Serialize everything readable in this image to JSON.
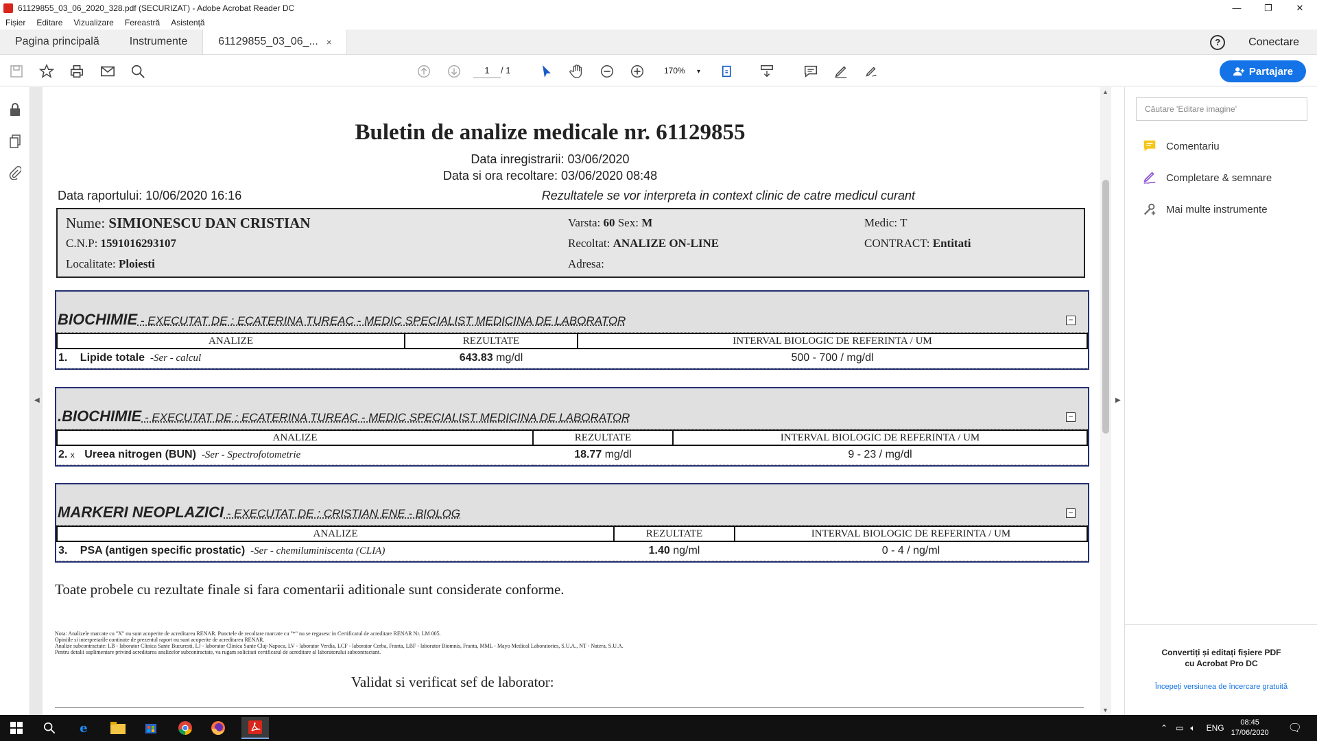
{
  "window": {
    "title": "61129855_03_06_2020_328.pdf (SECURIZAT) - Adobe Acrobat Reader DC",
    "minimize": "—",
    "restore": "❐",
    "close": "✕"
  },
  "menu": [
    "Fișier",
    "Editare",
    "Vizualizare",
    "Fereastră",
    "Asistență"
  ],
  "tabs": {
    "home": "Pagina principală",
    "tools": "Instrumente",
    "document": "61129855_03_06_...",
    "close": "×"
  },
  "header": {
    "help": "?",
    "signin": "Conectare"
  },
  "toolbar": {
    "page_current": "1",
    "page_total": "/ 1",
    "zoom": "170%",
    "zoom_caret": "▾",
    "share": "Partajare"
  },
  "icons": {
    "save": "save-icon",
    "star": "star-icon",
    "print": "print-icon",
    "mail": "mail-icon",
    "search": "search-icon"
  },
  "right_panel": {
    "search_placeholder": "Căutare 'Editare imagine'",
    "items": [
      "Comentariu",
      "Completare & semnare",
      "Mai multe instrumente"
    ],
    "promo_line1": "Convertiți și editați fișiere PDF",
    "promo_line2": "cu Acrobat Pro DC",
    "promo_link": "Începeți versiunea de încercare gratuită"
  },
  "document": {
    "title": "Buletin de analize medicale nr. 61129855",
    "date_reg": "Data inregistrarii: 03/06/2020",
    "date_collect": "Data si ora recoltare: 03/06/2020 08:48",
    "report_date": "Data raportului: 10/06/2020 16:16",
    "report_note": "Rezultatele se vor interpreta in context clinic de catre medicul curant",
    "patient": {
      "name_label": "Nume:",
      "name": "SIMIONESCU DAN CRISTIAN",
      "cnp_label": "C.N.P:",
      "cnp": "1591016293107",
      "loc_label": "Localitate:",
      "loc": "Ploiesti",
      "age_label": "Varsta:",
      "age": "60",
      "sex_label": "Sex:",
      "sex": "M",
      "collected_label": "Recoltat:",
      "collected": "ANALIZE ON-LINE",
      "address_label": "Adresa:",
      "medic_label": "Medic:",
      "medic": "T",
      "contract_label": "CONTRACT:",
      "contract": "Entitati"
    },
    "columns": {
      "analysis": "ANALIZE",
      "result": "REZULTATE",
      "interval": "INTERVAL BIOLOGIC DE REFERINTA / UM"
    },
    "sections": [
      {
        "name": "BIOCHIMIE",
        "executed": " - EXECUTAT DE : ECATERINA TUREAC - MEDIC SPECIALIST MEDICINA DE LABORATOR",
        "minus": "−",
        "row": {
          "num": "1.",
          "flag": "",
          "test": "Lipide totale",
          "method": "-Ser - calcul",
          "value": "643.83",
          "unit": "mg/dl",
          "ref": "500 - 700 / mg/dl"
        }
      },
      {
        "name": ".BIOCHIMIE",
        "executed": " - EXECUTAT DE : ECATERINA TUREAC - MEDIC SPECIALIST MEDICINA DE LABORATOR",
        "minus": "−",
        "row": {
          "num": "2.",
          "flag": "x",
          "test": "Ureea nitrogen (BUN)",
          "method": "-Ser - Spectrofotometrie",
          "value": "18.77",
          "unit": "mg/dl",
          "ref": "9 - 23 / mg/dl"
        }
      },
      {
        "name": "MARKERI NEOPLAZICI",
        "executed": " - EXECUTAT DE : CRISTIAN ENE - BIOLOG",
        "minus": "−",
        "row": {
          "num": "3.",
          "flag": "",
          "test": "PSA (antigen specific prostatic)",
          "method": "-Ser - chemiluminiscenta (CLIA)",
          "value": "1.40",
          "unit": "ng/ml",
          "ref": "0 - 4 / ng/ml"
        }
      }
    ],
    "conformity": "Toate probele cu rezultate finale si fara comentarii aditionale sunt considerate conforme.",
    "notes": [
      "Nota: Analizele marcate cu \"X\" nu sunt acoperite de acreditarea RENAR. Punctele de recoltare marcate cu \"*\" nu se regasesc in Certificatul de acreditare RENAR Nr. LM 005.",
      "Opiniile si interpretarile continute de prezentul raport nu sunt acoperite de acreditarea RENAR.",
      "Analize subcontractate: LB - laborator Clinica Sante Bucuresti, LJ - laborator Clinica Sante Cluj-Napoca, LV - laborator Verdia, LCF - laborator Cerba, Franta, LBF - laborator Biomnis, Franta, MML - Mayo Medical Laboratories, S.U.A., NT - Natera, S.U.A.",
      "Pentru detalii suplimentare privind acreditarea analizelor subcontractate, va rugam solicitati certificatul de acreditare al laboratorului subcontractant."
    ],
    "validated": "Validat si verificat sef de laborator:"
  },
  "taskbar": {
    "lang": "ENG",
    "time": "08:45",
    "date": "17/06/2020"
  }
}
